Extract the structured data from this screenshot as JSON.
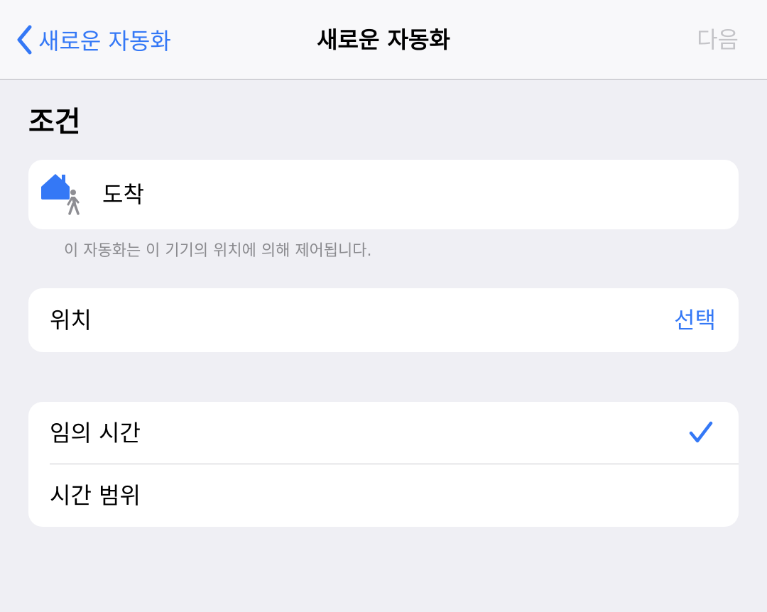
{
  "navbar": {
    "back_label": "새로운 자동화",
    "title": "새로운 자동화",
    "next_label": "다음"
  },
  "section": {
    "title": "조건"
  },
  "trigger": {
    "icon": "home-arrive-icon",
    "label": "도착"
  },
  "footnote": "이 자동화는 이 기기의 위치에 의해 제어됩니다.",
  "location": {
    "label": "위치",
    "action_label": "선택"
  },
  "time_options": [
    {
      "label": "임의 시간",
      "selected": true
    },
    {
      "label": "시간 범위",
      "selected": false
    }
  ],
  "colors": {
    "accent": "#3478f6",
    "background": "#efeff4",
    "disabled": "#c4c4c8",
    "secondary_text": "#8a8a8e"
  }
}
